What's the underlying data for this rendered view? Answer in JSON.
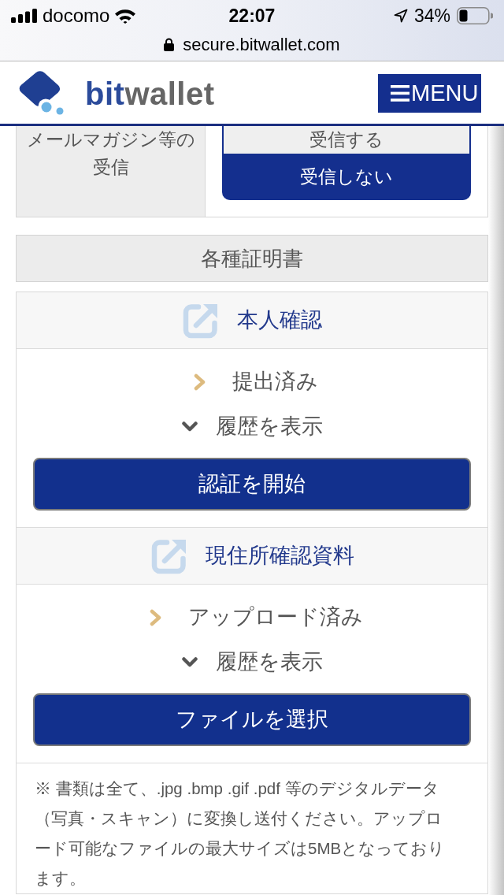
{
  "status_bar": {
    "carrier": "docomo",
    "time": "22:07",
    "battery": "34%"
  },
  "address_bar": {
    "url": "secure.bitwallet.com"
  },
  "header": {
    "logo": {
      "prefix": "bit",
      "suffix": "wallet"
    },
    "menu_button": "MENU"
  },
  "mail_setting": {
    "label": "メールマガジン等の受信",
    "options": [
      {
        "label": "受信する",
        "selected": false
      },
      {
        "label": "受信しない",
        "selected": true
      }
    ]
  },
  "certificates": {
    "title": "各種証明書",
    "sections": [
      {
        "title": "本人確認",
        "status": "提出済み",
        "history_toggle": "履歴を表示",
        "action_button": "認証を開始"
      },
      {
        "title": "現住所確認資料",
        "status": "アップロード済み",
        "history_toggle": "履歴を表示",
        "action_button": "ファイルを選択"
      }
    ],
    "note": "※ 書類は全て、.jpg .bmp .gif .pdf 等のデジタルデータ（写真・スキャン）に変換し送付ください。アップロード可能なファイルの最大サイズは5MBとなっております。"
  }
}
